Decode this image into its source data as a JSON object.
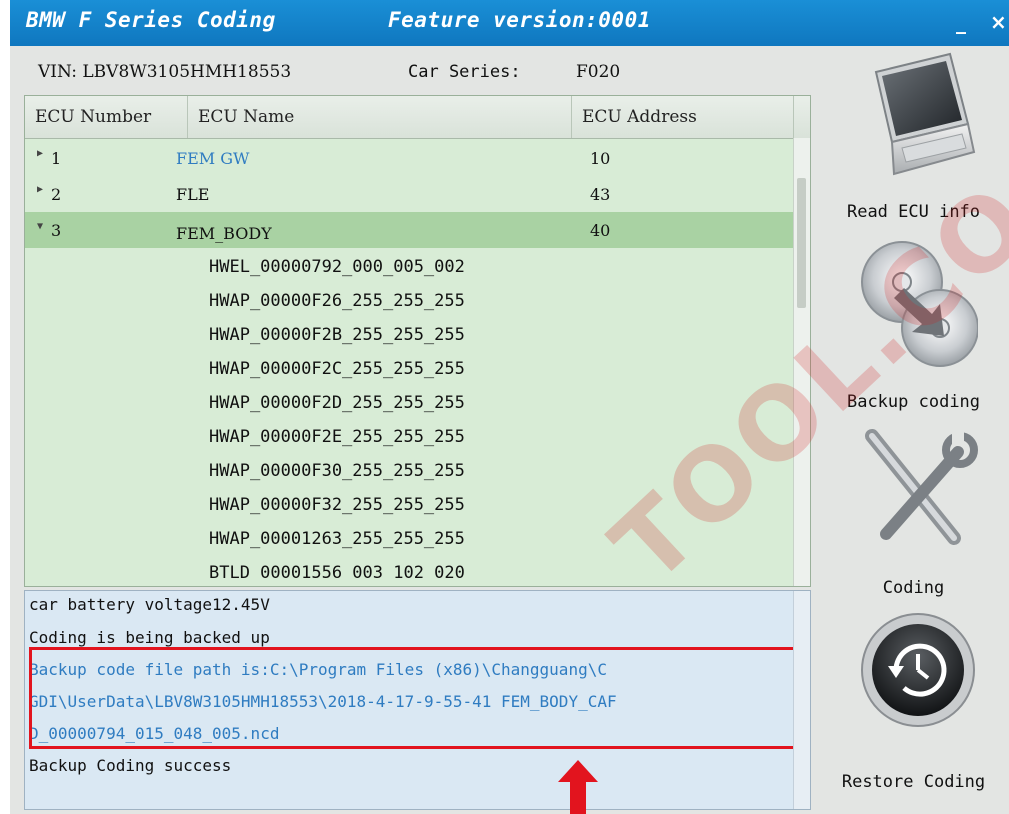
{
  "window": {
    "title": "BMW F Series Coding",
    "feature_version": "Feature version:0001",
    "minimize": "_",
    "close": "×"
  },
  "info": {
    "vin": "VIN: LBV8W3105HMH18553",
    "car_series_label": "Car Series:",
    "car_series_value": "F020"
  },
  "grid": {
    "headers": [
      "ECU Number",
      "ECU Name",
      "ECU Address"
    ],
    "rows": [
      {
        "number": "1",
        "name": "FEM GW",
        "address": "10"
      },
      {
        "number": "2",
        "name": "FLE",
        "address": "43"
      },
      {
        "number": "3",
        "name": "FEM_BODY",
        "address": "40"
      }
    ],
    "sub_items": [
      "HWEL_00000792_000_005_002",
      "HWAP_00000F26_255_255_255",
      "HWAP_00000F2B_255_255_255",
      "HWAP_00000F2C_255_255_255",
      "HWAP_00000F2D_255_255_255",
      "HWAP_00000F2E_255_255_255",
      "HWAP_00000F30_255_255_255",
      "HWAP_00000F32_255_255_255",
      "HWAP_00001263_255_255_255",
      "BTLD 00001556 003 102 020"
    ]
  },
  "log": {
    "lines": [
      "car battery voltage12.45V",
      "Coding is being backed up",
      "Backup code file path is:C:\\Program Files (x86)\\Changguang\\C",
      "GDI\\UserData\\LBV8W3105HMH18553\\2018-4-17-9-55-41 FEM_BODY_CAF",
      "D_00000794_015_048_005.ncd",
      "Backup Coding success"
    ]
  },
  "side": {
    "read_ecu": "Read ECU info",
    "backup": "Backup coding",
    "coding": "Coding",
    "restore": "Restore Coding"
  },
  "watermark": "TOOL.CO",
  "colors": {
    "titlebar": "#1380c8",
    "grid_bg": "#d8ecd6",
    "selected_row": "#a9d2a3",
    "log_bg": "#dae8f3",
    "highlight": "#e2141e",
    "link_text": "#2f7cc1"
  }
}
